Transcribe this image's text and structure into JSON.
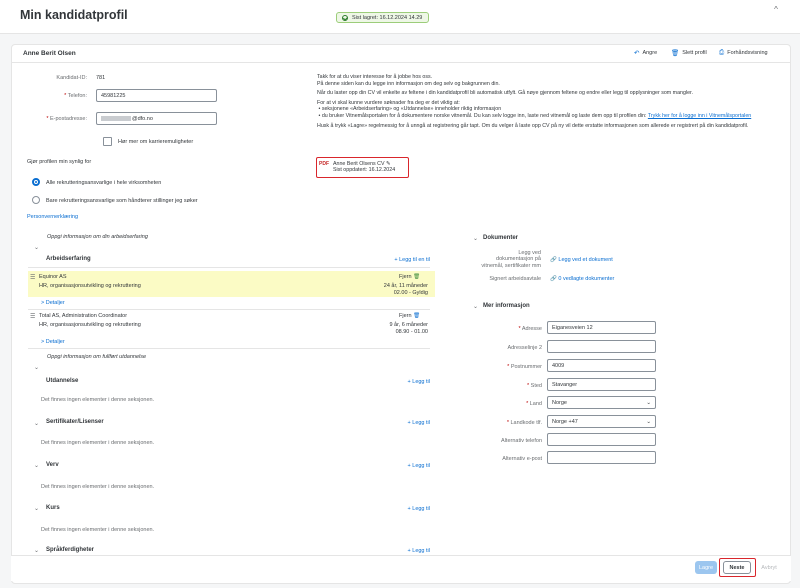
{
  "header": {
    "title": "Min kandidatprofil",
    "saved_status": "Sist lagret: 16.12.2024 14.29",
    "collapse_glyph": "^"
  },
  "profile": {
    "name": "Anne Berit Olsen",
    "actions": {
      "undo": "Angre",
      "delete": "Slett profil",
      "preview": "Forhåndsvisning"
    }
  },
  "form": {
    "candidate_id_label": "Kandidat-ID:",
    "candidate_id": "781",
    "phone_label": "Telefon:",
    "phone": "45981225",
    "email_label": "E-postadresse:",
    "email_domain": "@dfo.no",
    "career_checkbox": "Hør mer om karrieremuligheter",
    "visibility_title": "Gjør profilen min synlig for",
    "visibility_options": [
      "Alle rekrutteringsansvarlige i hele virksomheten",
      "Bare rekrutteringsansvarlige som håndterer stillinger jeg søker"
    ],
    "privacy_link": "Personvernerklæring"
  },
  "info": {
    "line1": "Takk for at du viser interesse for å jobbe hos oss.",
    "line2": "På denne siden kan du legge inn informasjon om deg selv og bakgrunnen din.",
    "line3": "Når du laster opp din CV vil enkelte av feltene i din kandidatprofil bli automatisk utfylt. Gå nøye gjennom feltene og endre eller legg til opplysninger som mangler.",
    "line4": "For at vi skal kunne vurdere søknader fra deg er det viktig at:",
    "bullet1": "seksjonene «Arbeidserfaring» og «Utdannelse» inneholder riktig informasjon",
    "bullet2": "du bruker Vitnemålsportalen for å dokumentere norske vitnemål. Du kan selv logge inn, laste ned vitnemål og laste dem opp til profilen din:",
    "bullet2_link": "Trykk her for å logge inn i Vitnemålsportalen",
    "line5": "Husk å trykk «Lagre» regelmessig for å unngå at registrering går tapt. Om du velger å laste opp CV på ny vil dette erstatte informasjonen som allerede er registrert på din kandidatprofil.",
    "cv_name": "Anne Berit Olsens CV",
    "cv_updated": "Sist oppdatert: 16.12.2024",
    "pdf_label": "PDF"
  },
  "experience": {
    "prompt": "Oppgi informasjon om din arbeidserfaring",
    "title": "Arbeidserfaring",
    "add": "+ Legg til en til",
    "items": [
      {
        "employer": "Equinor AS",
        "role": "HR, organisasjonsutvikling og rekruttering",
        "remove": "Fjern",
        "duration": "24 år, 11 måneder",
        "period": "02.00 - Gyldig",
        "details": "> Detaljer"
      },
      {
        "employer": "Total AS, Administration Coordinator",
        "role": "HR, organisasjonsutvikling og rekruttering",
        "remove": "Fjern",
        "duration": "9 år, 6 måneder",
        "period": "08.90 - 01.00",
        "details": "> Detaljer"
      }
    ]
  },
  "education": {
    "prompt": "Oppgi informasjon om fullført utdannelse",
    "title": "Utdannelse",
    "add": "+ Legg til",
    "empty": "Det finnes ingen elementer i denne seksjonen."
  },
  "sections": [
    {
      "title": "Sertifikater/Lisenser",
      "add": "+ Legg til",
      "empty": "Det finnes ingen elementer i denne seksjonen."
    },
    {
      "title": "Verv",
      "add": "+ Legg til",
      "empty": "Det finnes ingen elementer i denne seksjonen."
    },
    {
      "title": "Kurs",
      "add": "+ Legg til",
      "empty": "Det finnes ingen elementer i denne seksjonen."
    },
    {
      "title": "Språkferdigheter",
      "add": "+ Legg til",
      "empty": ""
    }
  ],
  "documents": {
    "title": "Dokumenter",
    "docs_label_1": "Legg ved",
    "docs_label_2": "dokumentasjon på",
    "docs_label_3": "vitnemål, sertifikater mm",
    "docs_link": "Legg ved et dokument",
    "agreement_label": "Signert arbeidsavtale",
    "agreement_link": "0 vedlagte dokumenter"
  },
  "more_info": {
    "title": "Mer informasjon",
    "address_label": "Adresse",
    "address": "Eiganesveien 12",
    "address2_label": "Adresselinje 2",
    "address2": "",
    "postal_label": "Postnummer",
    "postal": "4009",
    "city_label": "Sted",
    "city": "Stavanger",
    "country_label": "Land",
    "country": "Norge",
    "country_code_label": "Landkode tlf.",
    "country_code": "Norge +47",
    "alt_phone_label": "Alternativ telefon",
    "alt_phone": "",
    "alt_email_label": "Alternativ e-post",
    "alt_email": ""
  },
  "footer": {
    "save": "Lagre",
    "next": "Neste",
    "cancel": "Avbryt"
  },
  "colors": {
    "accent": "#0a6ed1",
    "highlight": "#fbfbc5",
    "marker": "#d9262c"
  }
}
